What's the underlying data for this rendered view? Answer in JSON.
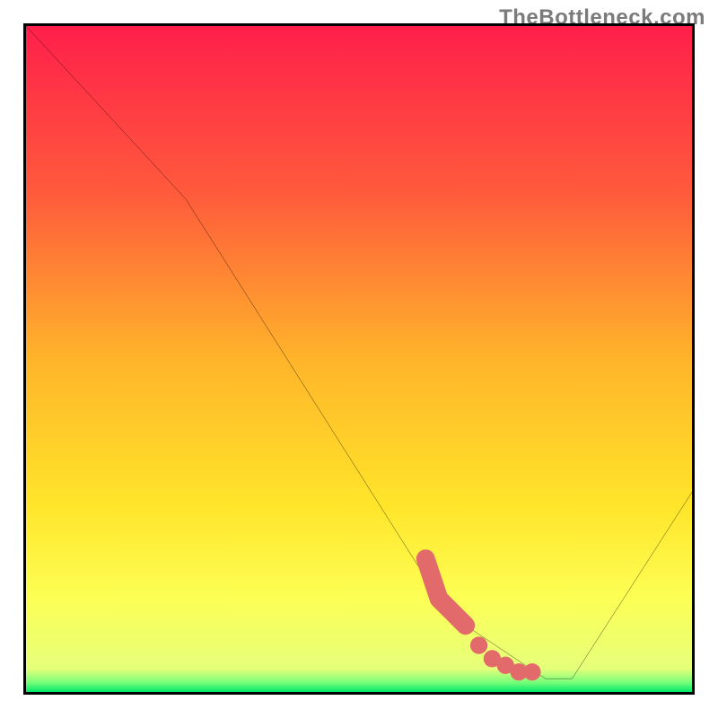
{
  "watermark": "TheBottleneck.com",
  "chart_data": {
    "type": "line",
    "title": "",
    "xlabel": "",
    "ylabel": "",
    "xlim": [
      0,
      100
    ],
    "ylim": [
      0,
      100
    ],
    "series": [
      {
        "name": "bottleneck-curve",
        "x": [
          0,
          24,
          62,
          66,
          78,
          82,
          100
        ],
        "y": [
          100,
          74,
          14,
          10,
          2,
          2,
          30
        ]
      }
    ],
    "highlight_segment": {
      "name": "recommended-range",
      "x": [
        60,
        62,
        64,
        66,
        68,
        70,
        72,
        74,
        76
      ],
      "y": [
        20,
        14,
        12,
        10,
        7,
        5,
        4,
        3,
        3
      ]
    },
    "gradient_stops": [
      {
        "pos": 0.0,
        "color": "#ff1f4b"
      },
      {
        "pos": 0.25,
        "color": "#ff5a3c"
      },
      {
        "pos": 0.5,
        "color": "#ffb42a"
      },
      {
        "pos": 0.72,
        "color": "#ffe52a"
      },
      {
        "pos": 0.86,
        "color": "#fcff55"
      },
      {
        "pos": 0.965,
        "color": "#e6ff7a"
      },
      {
        "pos": 0.985,
        "color": "#7cff7a"
      },
      {
        "pos": 1.0,
        "color": "#00e96b"
      }
    ]
  }
}
